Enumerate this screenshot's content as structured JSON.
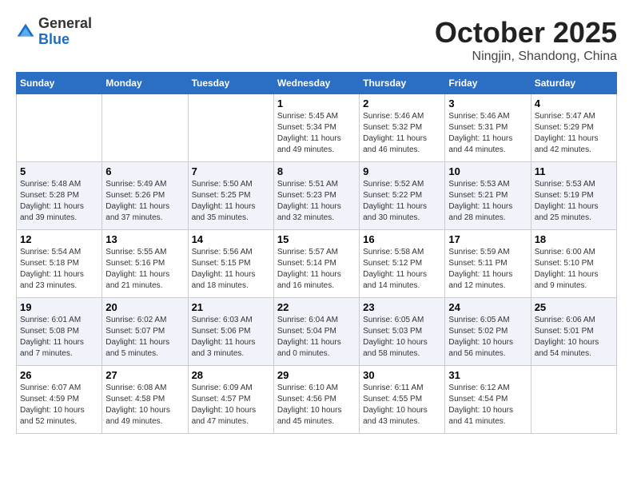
{
  "header": {
    "logo_line1": "General",
    "logo_line2": "Blue",
    "month": "October 2025",
    "location": "Ningjin, Shandong, China"
  },
  "days_of_week": [
    "Sunday",
    "Monday",
    "Tuesday",
    "Wednesday",
    "Thursday",
    "Friday",
    "Saturday"
  ],
  "weeks": [
    [
      {
        "day": "",
        "info": ""
      },
      {
        "day": "",
        "info": ""
      },
      {
        "day": "",
        "info": ""
      },
      {
        "day": "1",
        "info": "Sunrise: 5:45 AM\nSunset: 5:34 PM\nDaylight: 11 hours\nand 49 minutes."
      },
      {
        "day": "2",
        "info": "Sunrise: 5:46 AM\nSunset: 5:32 PM\nDaylight: 11 hours\nand 46 minutes."
      },
      {
        "day": "3",
        "info": "Sunrise: 5:46 AM\nSunset: 5:31 PM\nDaylight: 11 hours\nand 44 minutes."
      },
      {
        "day": "4",
        "info": "Sunrise: 5:47 AM\nSunset: 5:29 PM\nDaylight: 11 hours\nand 42 minutes."
      }
    ],
    [
      {
        "day": "5",
        "info": "Sunrise: 5:48 AM\nSunset: 5:28 PM\nDaylight: 11 hours\nand 39 minutes."
      },
      {
        "day": "6",
        "info": "Sunrise: 5:49 AM\nSunset: 5:26 PM\nDaylight: 11 hours\nand 37 minutes."
      },
      {
        "day": "7",
        "info": "Sunrise: 5:50 AM\nSunset: 5:25 PM\nDaylight: 11 hours\nand 35 minutes."
      },
      {
        "day": "8",
        "info": "Sunrise: 5:51 AM\nSunset: 5:23 PM\nDaylight: 11 hours\nand 32 minutes."
      },
      {
        "day": "9",
        "info": "Sunrise: 5:52 AM\nSunset: 5:22 PM\nDaylight: 11 hours\nand 30 minutes."
      },
      {
        "day": "10",
        "info": "Sunrise: 5:53 AM\nSunset: 5:21 PM\nDaylight: 11 hours\nand 28 minutes."
      },
      {
        "day": "11",
        "info": "Sunrise: 5:53 AM\nSunset: 5:19 PM\nDaylight: 11 hours\nand 25 minutes."
      }
    ],
    [
      {
        "day": "12",
        "info": "Sunrise: 5:54 AM\nSunset: 5:18 PM\nDaylight: 11 hours\nand 23 minutes."
      },
      {
        "day": "13",
        "info": "Sunrise: 5:55 AM\nSunset: 5:16 PM\nDaylight: 11 hours\nand 21 minutes."
      },
      {
        "day": "14",
        "info": "Sunrise: 5:56 AM\nSunset: 5:15 PM\nDaylight: 11 hours\nand 18 minutes."
      },
      {
        "day": "15",
        "info": "Sunrise: 5:57 AM\nSunset: 5:14 PM\nDaylight: 11 hours\nand 16 minutes."
      },
      {
        "day": "16",
        "info": "Sunrise: 5:58 AM\nSunset: 5:12 PM\nDaylight: 11 hours\nand 14 minutes."
      },
      {
        "day": "17",
        "info": "Sunrise: 5:59 AM\nSunset: 5:11 PM\nDaylight: 11 hours\nand 12 minutes."
      },
      {
        "day": "18",
        "info": "Sunrise: 6:00 AM\nSunset: 5:10 PM\nDaylight: 11 hours\nand 9 minutes."
      }
    ],
    [
      {
        "day": "19",
        "info": "Sunrise: 6:01 AM\nSunset: 5:08 PM\nDaylight: 11 hours\nand 7 minutes."
      },
      {
        "day": "20",
        "info": "Sunrise: 6:02 AM\nSunset: 5:07 PM\nDaylight: 11 hours\nand 5 minutes."
      },
      {
        "day": "21",
        "info": "Sunrise: 6:03 AM\nSunset: 5:06 PM\nDaylight: 11 hours\nand 3 minutes."
      },
      {
        "day": "22",
        "info": "Sunrise: 6:04 AM\nSunset: 5:04 PM\nDaylight: 11 hours\nand 0 minutes."
      },
      {
        "day": "23",
        "info": "Sunrise: 6:05 AM\nSunset: 5:03 PM\nDaylight: 10 hours\nand 58 minutes."
      },
      {
        "day": "24",
        "info": "Sunrise: 6:05 AM\nSunset: 5:02 PM\nDaylight: 10 hours\nand 56 minutes."
      },
      {
        "day": "25",
        "info": "Sunrise: 6:06 AM\nSunset: 5:01 PM\nDaylight: 10 hours\nand 54 minutes."
      }
    ],
    [
      {
        "day": "26",
        "info": "Sunrise: 6:07 AM\nSunset: 4:59 PM\nDaylight: 10 hours\nand 52 minutes."
      },
      {
        "day": "27",
        "info": "Sunrise: 6:08 AM\nSunset: 4:58 PM\nDaylight: 10 hours\nand 49 minutes."
      },
      {
        "day": "28",
        "info": "Sunrise: 6:09 AM\nSunset: 4:57 PM\nDaylight: 10 hours\nand 47 minutes."
      },
      {
        "day": "29",
        "info": "Sunrise: 6:10 AM\nSunset: 4:56 PM\nDaylight: 10 hours\nand 45 minutes."
      },
      {
        "day": "30",
        "info": "Sunrise: 6:11 AM\nSunset: 4:55 PM\nDaylight: 10 hours\nand 43 minutes."
      },
      {
        "day": "31",
        "info": "Sunrise: 6:12 AM\nSunset: 4:54 PM\nDaylight: 10 hours\nand 41 minutes."
      },
      {
        "day": "",
        "info": ""
      }
    ]
  ]
}
